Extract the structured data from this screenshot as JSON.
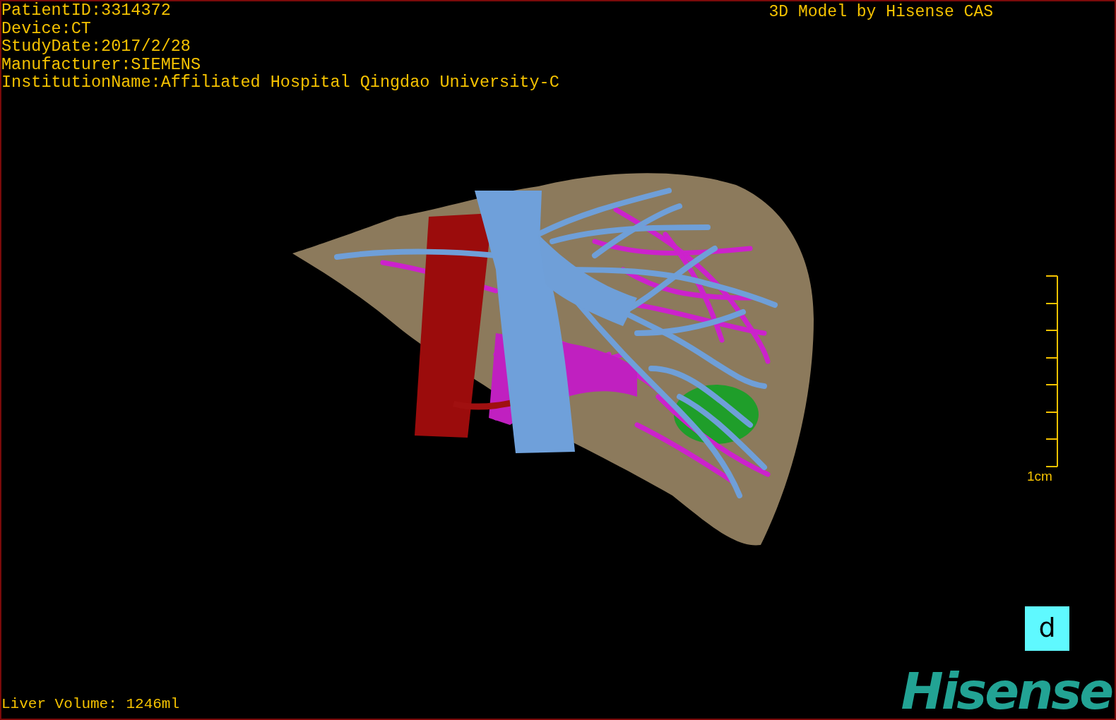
{
  "info_lines": [
    "PatientID:3314372",
    "Device:CT",
    "StudyDate:2017/2/28",
    "Manufacturer:SIEMENS",
    "InstitutionName:Affiliated Hospital Qingdao University-C"
  ],
  "title": "3D Model by Hisense CAS",
  "scale_bar": {
    "label": "1cm"
  },
  "liver_volume": "Liver Volume: 1246ml",
  "view_button": "d",
  "logo": "Hisense"
}
